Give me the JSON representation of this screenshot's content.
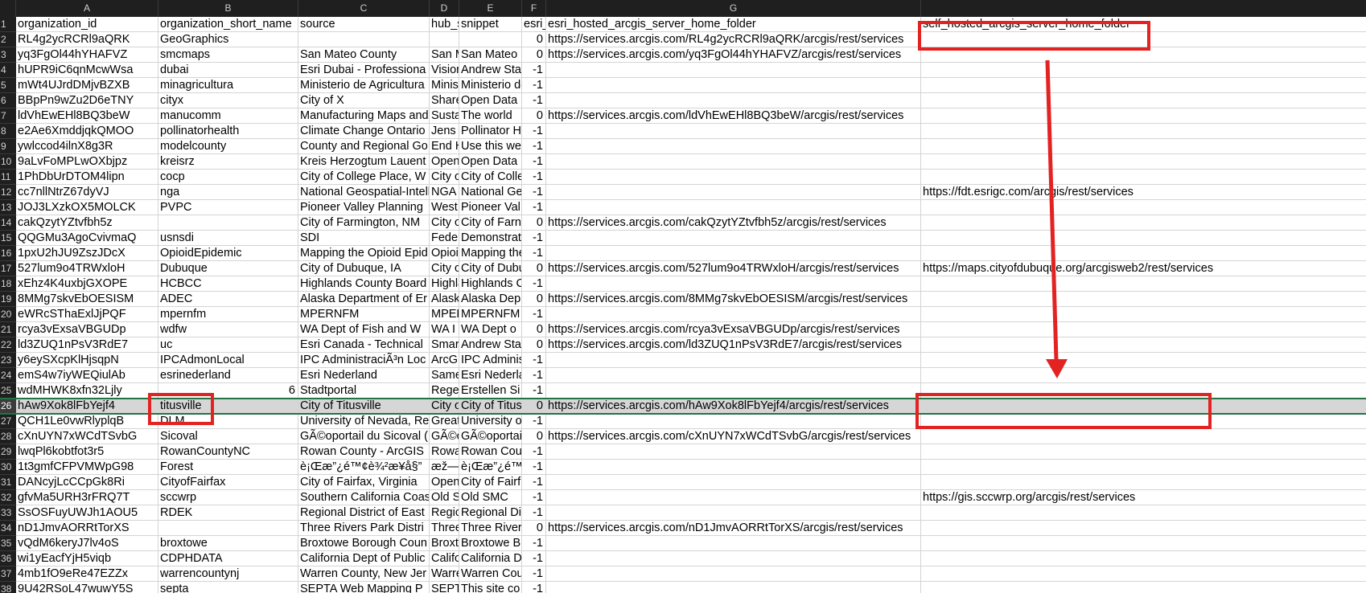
{
  "columns": [
    "A",
    "B",
    "C",
    "D",
    "E",
    "F",
    "G"
  ],
  "header": [
    "organization_id",
    "organization_short_name",
    "source",
    "hub_s",
    "snippet",
    "esri_",
    "esri_hosted_arcgis_server_home_folder",
    "self_hosted_arcgis_server_home_folder"
  ],
  "rows": [
    {
      "n": "2",
      "a": "RL4g2ycRCRl9aQRK",
      "b": "GeoGraphics",
      "c": "",
      "d": "",
      "e": "",
      "f": "0",
      "g": "https://services.arcgis.com/RL4g2ycRCRl9aQRK/arcgis/rest/services",
      "h": ""
    },
    {
      "n": "3",
      "a": "yq3FgOl44hYHAFVZ",
      "b": "smcmaps",
      "c": "San Mateo County",
      "d": "San M",
      "e": "San Mateo",
      "f": "0",
      "g": "https://services.arcgis.com/yq3FgOl44hYHAFVZ/arcgis/rest/services",
      "h": ""
    },
    {
      "n": "4",
      "a": "hUPR9iC6qnMcwWsa",
      "b": "dubai",
      "c": "Esri Dubai - Professiona",
      "d": "Visior",
      "e": "Andrew Sta",
      "f": "-1",
      "g": "",
      "h": ""
    },
    {
      "n": "5",
      "a": "mWt4UJrdDMjvBZXB",
      "b": "minagricultura",
      "c": "Ministerio de Agricultura",
      "d": "Minist",
      "e": "Ministerio de",
      "f": "-1",
      "g": "",
      "h": ""
    },
    {
      "n": "6",
      "a": "BBpPn9wZu2D6eTNY",
      "b": "cityx",
      "c": "City of X",
      "d": "Share",
      "e": "Open Data",
      "f": "-1",
      "g": "",
      "h": ""
    },
    {
      "n": "7",
      "a": "ldVhEwEHl8BQ3beW",
      "b": "manucomm",
      "c": "Manufacturing Maps and",
      "d": "Susta",
      "e": "The world",
      "f": "0",
      "g": "https://services.arcgis.com/ldVhEwEHl8BQ3beW/arcgis/rest/services",
      "h": ""
    },
    {
      "n": "8",
      "a": "e2Ae6XmddjqkQMOO",
      "b": "pollinatorhealth",
      "c": "Climate Change Ontario",
      "d": "Jens",
      "e": "Pollinator H",
      "f": "-1",
      "g": "",
      "h": ""
    },
    {
      "n": "9",
      "a": "ywlccod4ilnX8g3R",
      "b": "modelcounty",
      "c": "County and Regional Go",
      "d": "End H",
      "e": "Use this we",
      "f": "-1",
      "g": "",
      "h": ""
    },
    {
      "n": "10",
      "a": "9aLvFoMPLwOXbjpz",
      "b": "kreisrz",
      "c": "Kreis Herzogtum Lauent",
      "d": "Open",
      "e": "Open Data",
      "f": "-1",
      "g": "",
      "h": ""
    },
    {
      "n": "11",
      "a": "1PhDbUrDTOM4lipn",
      "b": "cocp",
      "c": "City of College Place, W",
      "d": "City o",
      "e": "City of Colle",
      "f": "-1",
      "g": "",
      "h": ""
    },
    {
      "n": "12",
      "a": "cc7nllNtrZ67dyVJ",
      "b": "nga",
      "c": "National Geospatial-Intell",
      "d": "NGA",
      "e": "National Ge",
      "f": "-1",
      "g": "",
      "h": "https://fdt.esrigc.com/arcgis/rest/services"
    },
    {
      "n": "13",
      "a": "JOJ3LXzkOX5MOLCK",
      "b": "PVPC",
      "c": "Pioneer Valley Planning",
      "d": "West",
      "e": "Pioneer Val",
      "f": "-1",
      "g": "",
      "h": ""
    },
    {
      "n": "14",
      "a": "cakQzytYZtvfbh5z",
      "b": "",
      "c": "City of Farmington, NM",
      "d": "City o",
      "e": "City of Farn",
      "f": "0",
      "g": "https://services.arcgis.com/cakQzytYZtvfbh5z/arcgis/rest/services",
      "h": ""
    },
    {
      "n": "15",
      "a": "QQGMu3AgoCvivmaQ",
      "b": "usnsdi",
      "c": "SDI",
      "d": "Feder",
      "e": "Demonstrat",
      "f": "-1",
      "g": "",
      "h": ""
    },
    {
      "n": "16",
      "a": "1pxU2hJU9ZszJDcX",
      "b": "OpioidEpidemic",
      "c": "Mapping the Opioid Epid",
      "d": "Opioi",
      "e": "Mapping the",
      "f": "-1",
      "g": "",
      "h": ""
    },
    {
      "n": "17",
      "a": "527lum9o4TRWxloH",
      "b": "Dubuque",
      "c": "City of Dubuque, IA",
      "d": "City o",
      "e": "City of Dubu",
      "f": "0",
      "g": "https://services.arcgis.com/527lum9o4TRWxloH/arcgis/rest/services",
      "h": "https://maps.cityofdubuque.org/arcgisweb2/rest/services"
    },
    {
      "n": "18",
      "a": "xEhz4K4uxbjGXOPE",
      "b": "HCBCC",
      "c": "Highlands County Board",
      "d": "Highla",
      "e": "Highlands C",
      "f": "-1",
      "g": "",
      "h": ""
    },
    {
      "n": "19",
      "a": "8MMg7skvEbOESISM",
      "b": "ADEC",
      "c": "Alaska Department of Er",
      "d": "Alask",
      "e": "Alaska Dep",
      "f": "0",
      "g": "https://services.arcgis.com/8MMg7skvEbOESISM/arcgis/rest/services",
      "h": ""
    },
    {
      "n": "20",
      "a": "eWRcSThaExlJjPQF",
      "b": "mpernfm",
      "c": "MPERNFM",
      "d": "MPEF",
      "e": "MPERNFM",
      "f": "-1",
      "g": "",
      "h": ""
    },
    {
      "n": "21",
      "a": "rcya3vExsaVBGUDp",
      "b": "wdfw",
      "c": " WA Dept of Fish and W",
      "d": " WA I",
      "e": " WA Dept o",
      "f": "0",
      "g": "https://services.arcgis.com/rcya3vExsaVBGUDp/arcgis/rest/services",
      "h": ""
    },
    {
      "n": "22",
      "a": "ld3ZUQ1nPsV3RdE7",
      "b": "uc",
      "c": "Esri Canada - Technical",
      "d": "Smar",
      "e": "Andrew Sta",
      "f": "0",
      "g": "https://services.arcgis.com/ld3ZUQ1nPsV3RdE7/arcgis/rest/services",
      "h": ""
    },
    {
      "n": "23",
      "a": "y6eySXcpKlHjsqpN",
      "b": "IPCAdmonLocal",
      "c": "IPC AdministraciÃ³n Loc",
      "d": "ArcGI",
      "e": "IPC Adminis",
      "f": "-1",
      "g": "",
      "h": ""
    },
    {
      "n": "24",
      "a": "emS4w7iyWEQiulAb",
      "b": "esrinederland",
      "c": "Esri Nederland",
      "d": "Same",
      "e": "Esri Nederla",
      "f": "-1",
      "g": "",
      "h": ""
    },
    {
      "n": "25",
      "a": "wdMHWK8xfn32Ljly",
      "b": "6",
      "c": "Stadtportal",
      "d": "Rege",
      "e": "Erstellen Si",
      "f": "-1",
      "g": "",
      "h": ""
    },
    {
      "n": "26",
      "a": "hAw9Xok8lFbYejf4",
      "b": "titusville",
      "c": "City of Titusville",
      "d": "City o",
      "e": "City of Titus",
      "f": "0",
      "g": "https://services.arcgis.com/hAw9Xok8lFbYejf4/arcgis/rest/services",
      "h": ""
    },
    {
      "n": "27",
      "a": "QCH1Le0vwRlyplqB",
      "b": "DLM",
      "c": "University of Nevada, Re",
      "d": "Great",
      "e": "University o",
      "f": "-1",
      "g": "",
      "h": ""
    },
    {
      "n": "28",
      "a": "cXnUYN7xWCdTSvbG",
      "b": "Sicoval",
      "c": "GÃ©oportail du Sicoval (",
      "d": "GÃ©c",
      "e": "GÃ©oportai",
      "f": "0",
      "g": "https://services.arcgis.com/cXnUYN7xWCdTSvbG/arcgis/rest/services",
      "h": ""
    },
    {
      "n": "29",
      "a": "lwqPl6kobtfot3r5",
      "b": "RowanCountyNC",
      "c": "Rowan County - ArcGIS",
      "d": "Rowa",
      "e": "Rowan Cou",
      "f": "-1",
      "g": "",
      "h": ""
    },
    {
      "n": "30",
      "a": "1t3gmfCFPVMWpG98",
      "b": "Forest",
      "c": "è¡Œæ”¿é™¢è¾²æ¥­å§”",
      "d": "æž—",
      "e": "è¡Œæ”¿é™",
      "f": "-1",
      "g": "",
      "h": ""
    },
    {
      "n": "31",
      "a": "DANcyjLcCCpGk8Ri",
      "b": "CityofFairfax",
      "c": "City of Fairfax, Virginia",
      "d": "Open",
      "e": "City of Fairf",
      "f": "-1",
      "g": "",
      "h": ""
    },
    {
      "n": "32",
      "a": "gfvMa5URH3rFRQ7T",
      "b": "sccwrp",
      "c": "Southern California Coas",
      "d": "Old S",
      "e": "Old SMC",
      "f": "-1",
      "g": "",
      "h": "https://gis.sccwrp.org/arcgis/rest/services"
    },
    {
      "n": "33",
      "a": "SsOSFuyUWJh1AOU5",
      "b": "RDEK",
      "c": "Regional District of East",
      "d": "Regic",
      "e": "Regional Di",
      "f": "-1",
      "g": "",
      "h": ""
    },
    {
      "n": "34",
      "a": "nD1JmvAORRtTorXS",
      "b": "",
      "c": "Three Rivers Park Distri",
      "d": "Three",
      "e": "Three River",
      "f": "0",
      "g": "https://services.arcgis.com/nD1JmvAORRtTorXS/arcgis/rest/services",
      "h": ""
    },
    {
      "n": "35",
      "a": "vQdM6keryJ7lv4oS",
      "b": "broxtowe",
      "c": "Broxtowe Borough Coun",
      "d": "Broxt",
      "e": "Broxtowe B",
      "f": "-1",
      "g": "",
      "h": ""
    },
    {
      "n": "36",
      "a": "wi1yEacfYjH5viqb",
      "b": "CDPHDATA",
      "c": "California Dept of Public",
      "d": "Califo",
      "e": "California D",
      "f": "-1",
      "g": "",
      "h": ""
    },
    {
      "n": "37",
      "a": "4mb1fO9eRe47EZZx",
      "b": "warrencountynj",
      "c": "Warren County, New Jer",
      "d": "Warre",
      "e": "Warren Cou",
      "f": "-1",
      "g": "",
      "h": ""
    },
    {
      "n": "38",
      "a": "9U42RSoL47wuwY5S",
      "b": "septa",
      "c": "SEPTA Web Mapping P",
      "d": "SEPT",
      "e": "This site co",
      "f": "-1",
      "g": "",
      "h": ""
    }
  ],
  "highlighted_row": "26",
  "colors": {
    "annotation_red": "#e32222",
    "selection_green": "#217346"
  }
}
